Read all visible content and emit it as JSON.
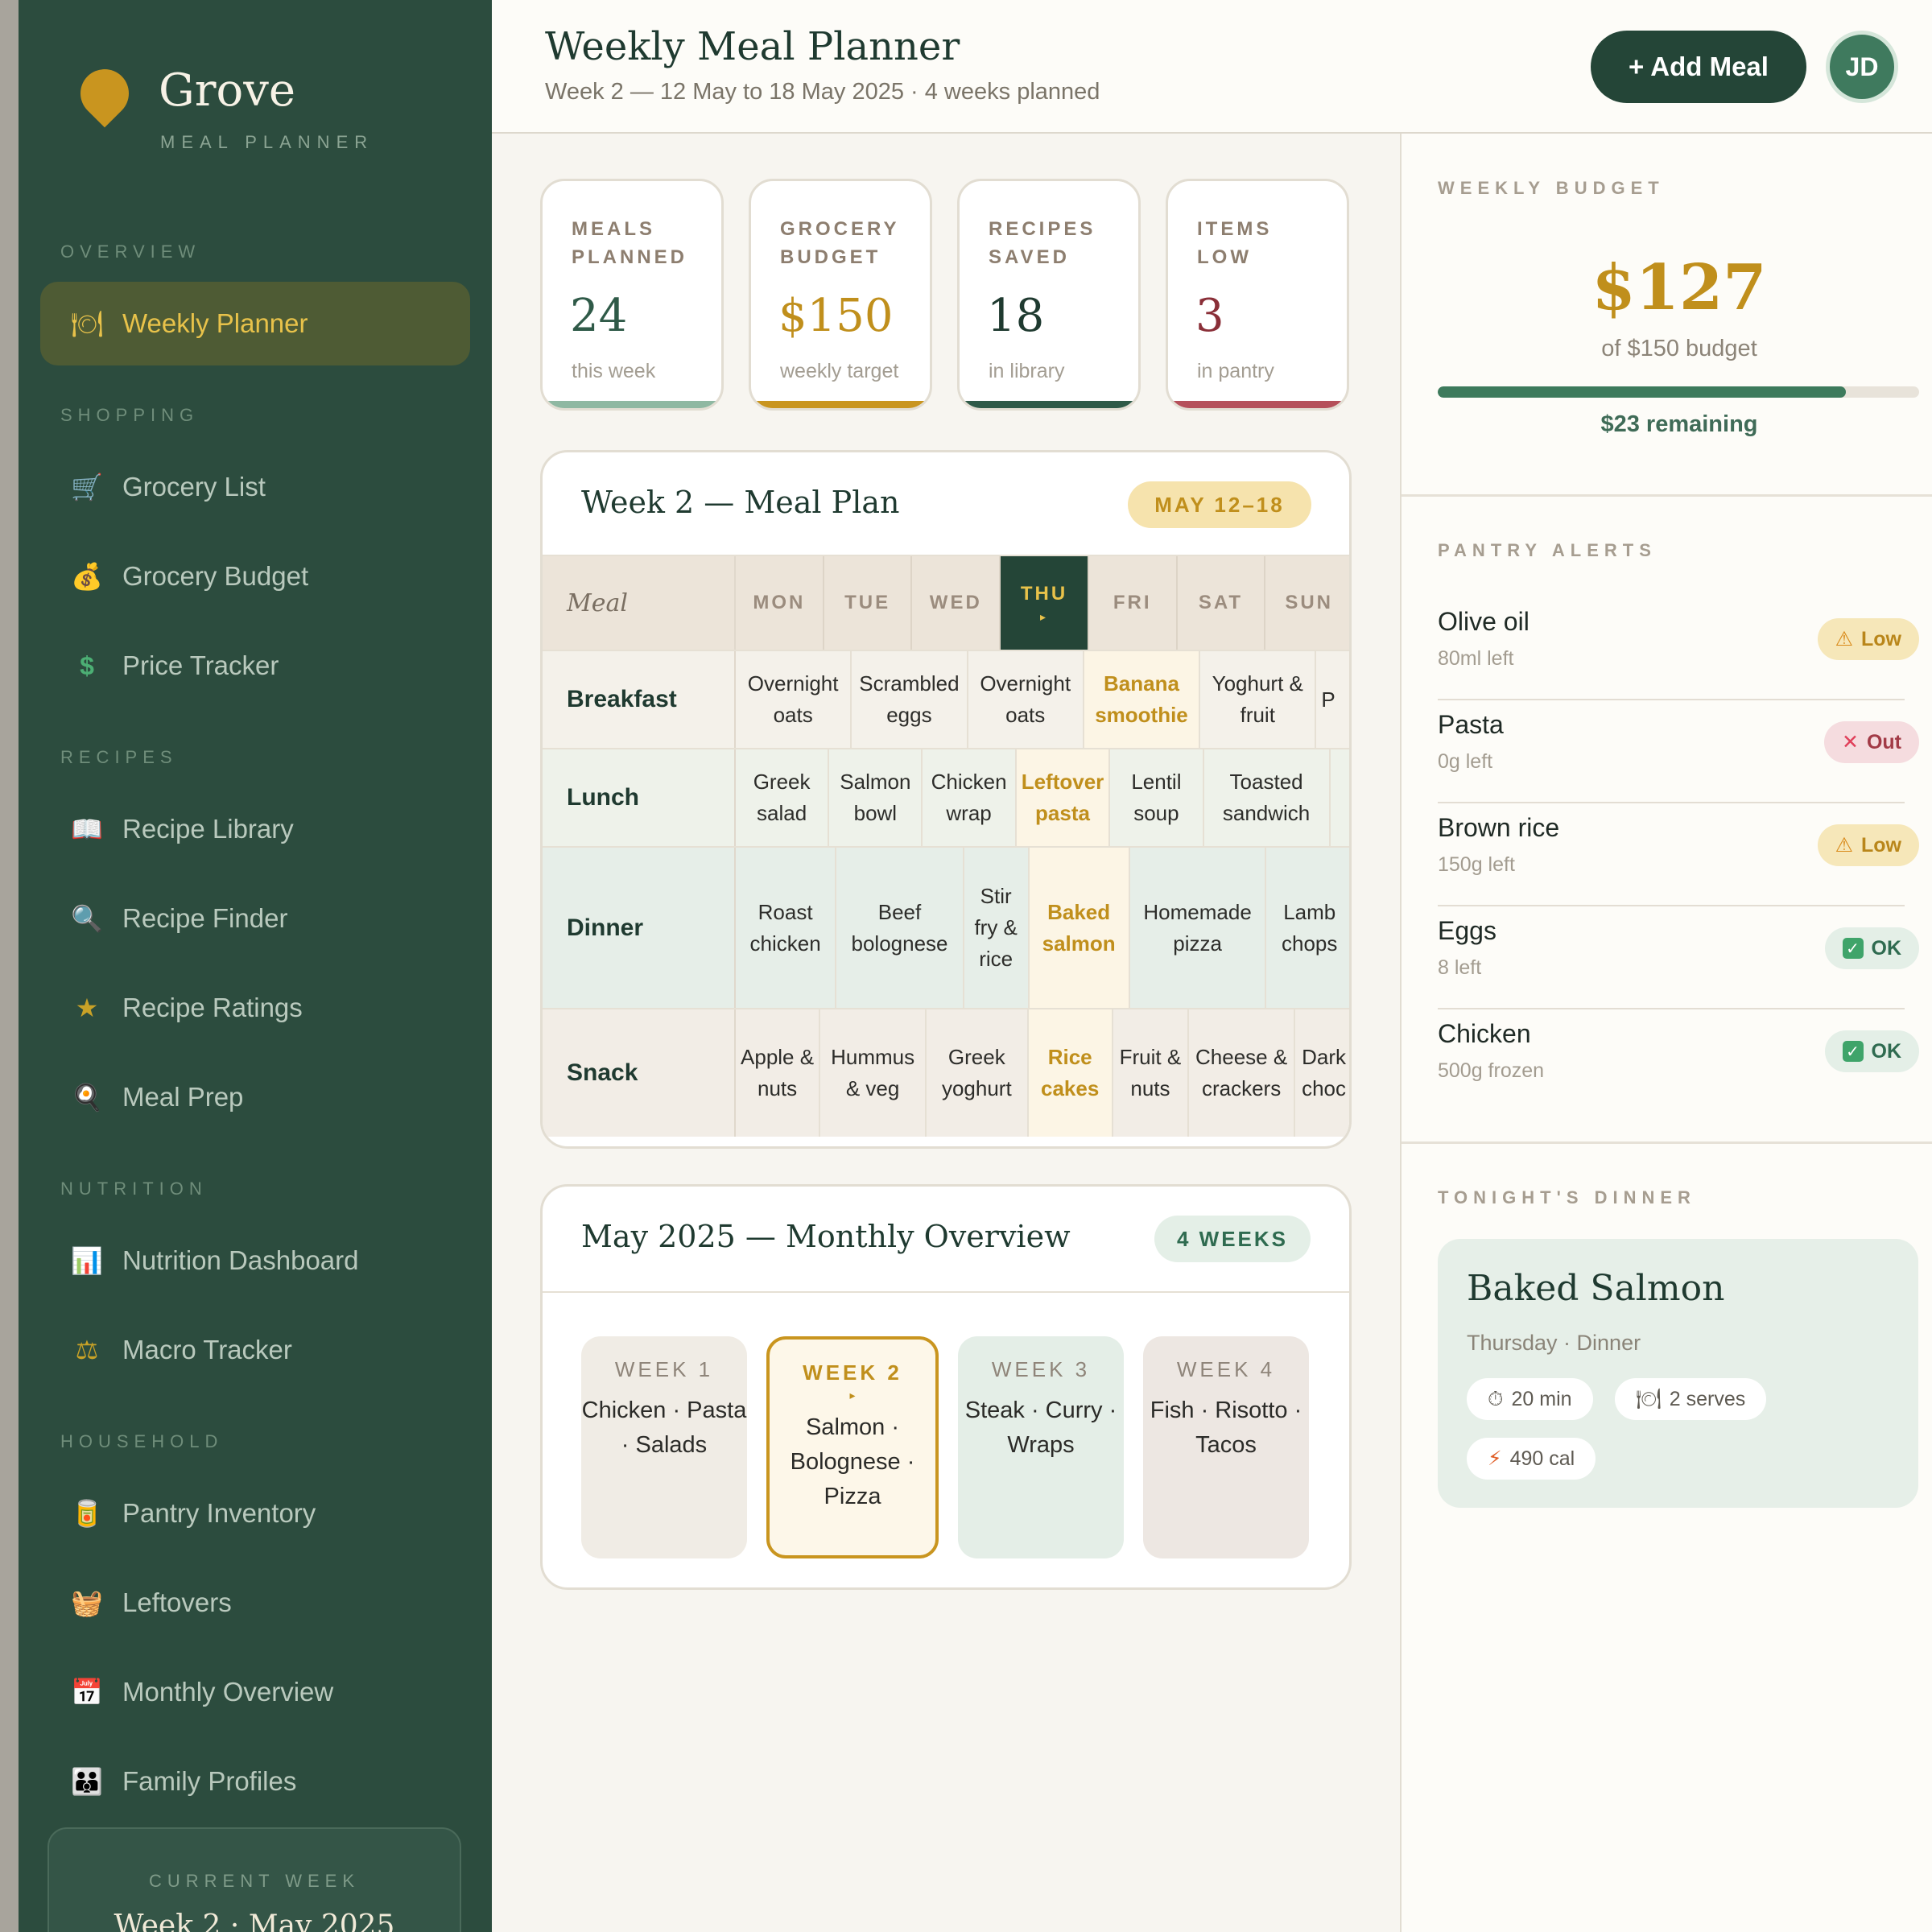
{
  "brand": {
    "name": "Grove",
    "subtitle": "MEAL PLANNER"
  },
  "sidebar": {
    "sections": {
      "overview": "OVERVIEW",
      "shopping": "SHOPPING",
      "recipes": "RECIPES",
      "nutrition": "NUTRITION",
      "household": "HOUSEHOLD"
    },
    "items": [
      {
        "label": "Weekly Planner",
        "icon": "plate-icon",
        "glyph": "🍽",
        "active": true
      },
      {
        "label": "Grocery List",
        "icon": "cart-icon",
        "glyph": "🛒"
      },
      {
        "label": "Grocery Budget",
        "icon": "money-bag-icon",
        "glyph": "💰"
      },
      {
        "label": "Price Tracker",
        "icon": "dollar-icon",
        "glyph": "$"
      },
      {
        "label": "Recipe Library",
        "icon": "book-icon",
        "glyph": "📖"
      },
      {
        "label": "Recipe Finder",
        "icon": "search-icon",
        "glyph": "🔍"
      },
      {
        "label": "Recipe Ratings",
        "icon": "star-icon",
        "glyph": "★"
      },
      {
        "label": "Meal Prep",
        "icon": "pan-icon",
        "glyph": "🍳"
      },
      {
        "label": "Nutrition Dashboard",
        "icon": "bar-chart-icon",
        "glyph": "📊"
      },
      {
        "label": "Macro Tracker",
        "icon": "scale-icon",
        "glyph": "⚖"
      },
      {
        "label": "Pantry Inventory",
        "icon": "jar-icon",
        "glyph": "🥫"
      },
      {
        "label": "Leftovers",
        "icon": "basket-icon",
        "glyph": "🧺"
      },
      {
        "label": "Monthly Overview",
        "icon": "calendar-icon",
        "glyph": "📅"
      },
      {
        "label": "Family Profiles",
        "icon": "family-icon",
        "glyph": "👪"
      }
    ],
    "current_week": {
      "label": "CURRENT WEEK",
      "value": "Week 2 · May 2025"
    }
  },
  "header": {
    "title": "Weekly Meal Planner",
    "subtitle": "Week 2 — 12 May to 18 May 2025 · 4 weeks planned",
    "add_button": "+ Add Meal",
    "avatar": "JD"
  },
  "stats": [
    {
      "label": "MEALS PLANNED",
      "value": "24",
      "note": "this week",
      "color": "#2f5a48",
      "bar": "#8fb8a2"
    },
    {
      "label": "GROCERY BUDGET",
      "value": "$150",
      "note": "weekly target",
      "color": "#c08f1c",
      "bar": "#c9951f"
    },
    {
      "label": "RECIPES SAVED",
      "value": "18",
      "note": "in library",
      "color": "#1f3a30",
      "bar": "#2f5a48"
    },
    {
      "label": "ITEMS LOW",
      "value": "3",
      "note": "in pantry",
      "color": "#8a2f38",
      "bar": "#b5505a"
    }
  ],
  "meal_plan": {
    "title": "Week 2 — Meal Plan",
    "range": "MAY 12–18",
    "meal_header": "Meal",
    "days": [
      "MON",
      "TUE",
      "WED",
      "THU",
      "FRI",
      "SAT",
      "SUN"
    ],
    "today_index": 3,
    "today_marker": "▸",
    "rows": [
      {
        "label": "Breakfast",
        "bg": "#f4f1ea",
        "cells": [
          "Overnight oats",
          "Scrambled eggs",
          "Overnight oats",
          "Banana smoothie",
          "Yoghurt & fruit",
          "P"
        ]
      },
      {
        "label": "Lunch",
        "bg": "#eef2ea",
        "cells": [
          "Greek salad",
          "Salmon bowl",
          "Chicken wrap",
          "Leftover pasta",
          "Lentil soup",
          "Toasted sandwich",
          ""
        ]
      },
      {
        "label": "Dinner",
        "bg": "#e6eee8",
        "cells": [
          "Roast chicken",
          "Beef bolognese",
          "Stir fry & rice",
          "Baked salmon",
          "Homemade pizza",
          "Lamb chops",
          ""
        ]
      },
      {
        "label": "Snack",
        "bg": "#f2ede6",
        "cells": [
          "Apple & nuts",
          "Hummus & veg",
          "Greek yoghurt",
          "Rice cakes",
          "Fruit & nuts",
          "Cheese & crackers",
          "Dark choc"
        ]
      }
    ]
  },
  "monthly": {
    "title": "May 2025 — Monthly Overview",
    "badge": "4 WEEKS",
    "weeks": [
      {
        "label": "WEEK 1",
        "meals": "Chicken · Pasta · Salads",
        "bg": "#f0ece5"
      },
      {
        "label": "WEEK 2",
        "marker": "▸",
        "meals": "Salmon · Bolognese · Pizza",
        "bg": "#fdf7e9",
        "current": true
      },
      {
        "label": "WEEK 3",
        "meals": "Steak · Curry · Wraps",
        "bg": "#e4eee7"
      },
      {
        "label": "WEEK 4",
        "meals": "Fish · Risotto · Tacos",
        "bg": "#ede7e2"
      }
    ]
  },
  "budget": {
    "label": "WEEKLY BUDGET",
    "spent": "$127",
    "of": "of $150 budget",
    "fraction": 0.847,
    "remaining": "$23 remaining"
  },
  "pantry": {
    "label": "PANTRY ALERTS",
    "items": [
      {
        "name": "Olive oil",
        "qty": "80ml left",
        "status": "Low",
        "icon": "warning-icon",
        "glyph": "⚠"
      },
      {
        "name": "Pasta",
        "qty": "0g left",
        "status": "Out",
        "icon": "cross-icon",
        "glyph": "✕"
      },
      {
        "name": "Brown rice",
        "qty": "150g left",
        "status": "Low",
        "icon": "warning-icon",
        "glyph": "⚠"
      },
      {
        "name": "Eggs",
        "qty": "8 left",
        "status": "OK",
        "icon": "check-icon",
        "glyph": "✓"
      },
      {
        "name": "Chicken",
        "qty": "500g frozen",
        "status": "OK",
        "icon": "check-icon",
        "glyph": "✓"
      }
    ]
  },
  "tonight": {
    "label": "TONIGHT'S DINNER",
    "name": "Baked Salmon",
    "meta": "Thursday · Dinner",
    "time": "20 min",
    "serves": "2 serves",
    "cal": "490 cal"
  },
  "colors": {
    "sidebar": "#2c4c3e",
    "accent_gold": "#c08f1c",
    "dark_green": "#244537",
    "low_bg": "#f6e7b9",
    "low_fg": "#b9861a",
    "out_bg": "#f5dcdf",
    "out_fg": "#a23a46",
    "ok_bg": "#e4efe7",
    "ok_fg": "#2f6b50"
  }
}
